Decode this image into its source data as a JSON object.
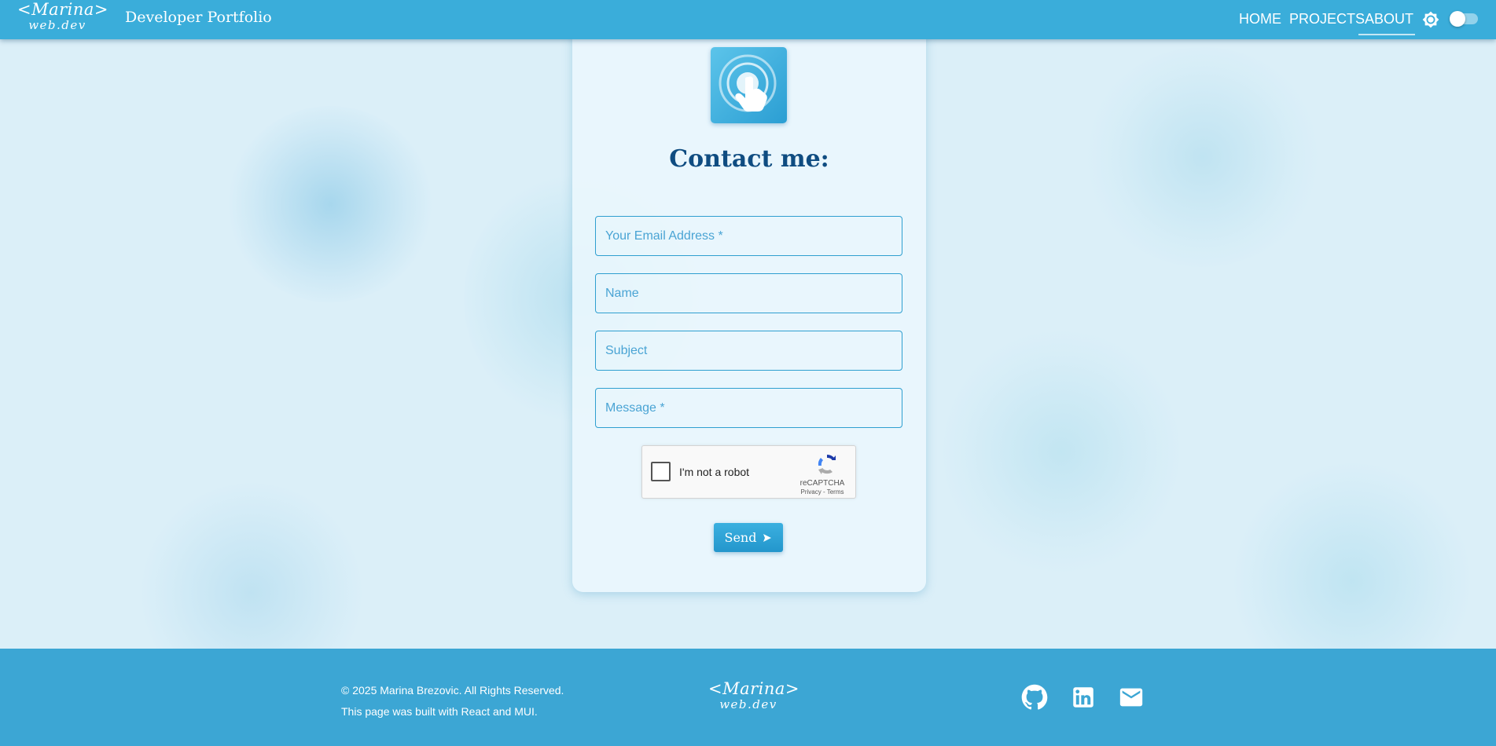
{
  "header": {
    "logo_line1": "<Marina>",
    "logo_line2": "web.dev",
    "site_title": "Developer Portfolio",
    "nav": [
      "HOME",
      "PROJECTS",
      "ABOUT"
    ],
    "active_nav": "ABOUT",
    "theme_icon": "brightness-icon",
    "dark_mode_toggle": "off"
  },
  "contact": {
    "icon": "touch-tap-icon",
    "title": "Contact me:",
    "fields": {
      "email_placeholder": "Your Email Address *",
      "name_placeholder": "Name",
      "subject_placeholder": "Subject",
      "message_placeholder": "Message *"
    },
    "recaptcha": {
      "label": "I'm not a robot",
      "brand": "reCAPTCHA",
      "links": "Privacy - Terms"
    },
    "send_label": "Send",
    "send_icon": "send-arrow-icon"
  },
  "footer": {
    "copyright": "© 2025 Marina Brezovic. All Rights Reserved.",
    "built_with": "This page was built with React and MUI.",
    "logo_line1": "<Marina>",
    "logo_line2": "web.dev",
    "social_icons": [
      "github-icon",
      "linkedin-icon",
      "email-icon"
    ]
  },
  "colors": {
    "header_bg": "#3aadda",
    "page_bg": "#dbeff8",
    "title": "#0f4c81",
    "field_border": "#2f9fd0",
    "footer_bg": "#3ca6d4"
  }
}
